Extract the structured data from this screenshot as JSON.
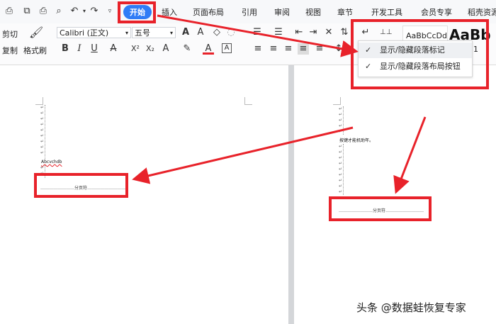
{
  "quick_access": {
    "icons": [
      "save-icon",
      "export-icon",
      "print-icon",
      "preview-icon",
      "undo-icon",
      "redo-icon",
      "more-icon"
    ]
  },
  "tabs": [
    "开始",
    "插入",
    "页面布局",
    "引用",
    "审阅",
    "视图",
    "章节",
    "开发工具",
    "会员专享",
    "稻壳资源"
  ],
  "ribbon": {
    "cut": "剪切",
    "copy": "复制",
    "format_painter": "格式刷",
    "font_name": "Calibri (正文)",
    "font_size": "五号",
    "style_preview": "AaBbCcDd",
    "style_preview_big": "AaBb",
    "extra_digit": "1"
  },
  "dropdown": {
    "items": [
      "显示/隐藏段落标记",
      "显示/隐藏段落布局按钮"
    ]
  },
  "left_doc": {
    "text": "Abcvchdb",
    "page_break": "……………………分页符………………………"
  },
  "right_doc": {
    "text": "按键才能机助年。",
    "page_break": "……………………分页符………………………"
  },
  "watermark": "头条 @数据蛙恢复专家",
  "colors": {
    "highlight": "#e8222a",
    "active_tab": "#2f7cf6"
  }
}
